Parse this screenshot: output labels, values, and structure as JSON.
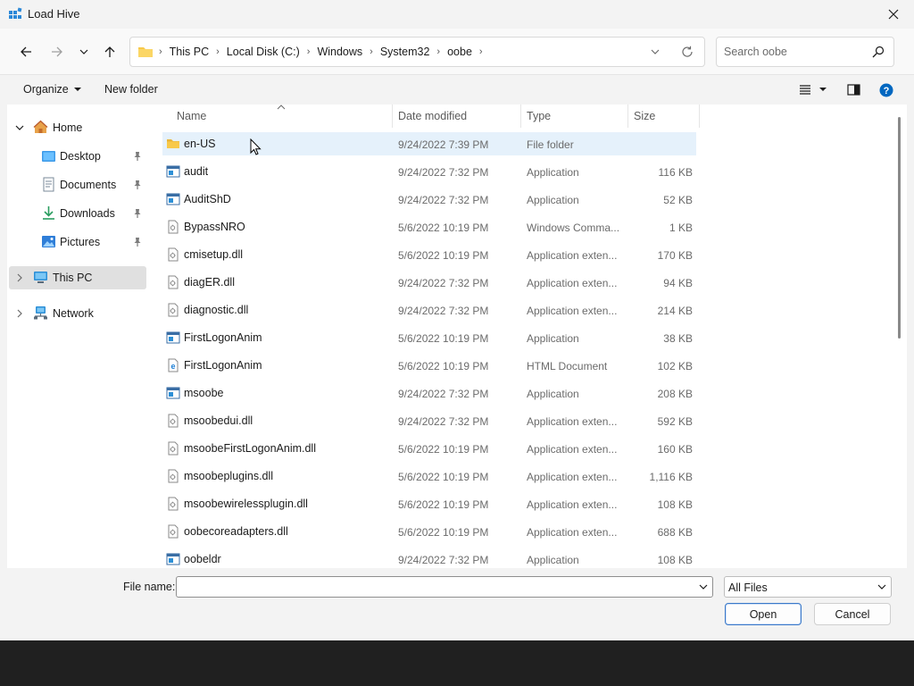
{
  "window": {
    "title": "Load Hive"
  },
  "address": {
    "crumbs": [
      "This PC",
      "Local Disk (C:)",
      "Windows",
      "System32",
      "oobe"
    ]
  },
  "search": {
    "placeholder": "Search oobe"
  },
  "toolbar": {
    "organize_label": "Organize",
    "new_folder_label": "New folder"
  },
  "sidebar": {
    "items": [
      {
        "label": "Home",
        "icon": "home-icon"
      },
      {
        "label": "Desktop",
        "icon": "desktop-icon",
        "pinned": true
      },
      {
        "label": "Documents",
        "icon": "documents-icon",
        "pinned": true
      },
      {
        "label": "Downloads",
        "icon": "downloads-icon",
        "pinned": true
      },
      {
        "label": "Pictures",
        "icon": "pictures-icon",
        "pinned": true
      },
      {
        "label": "This PC",
        "icon": "this-pc-icon",
        "selected": true
      },
      {
        "label": "Network",
        "icon": "network-icon"
      }
    ]
  },
  "columns": {
    "name": "Name",
    "date": "Date modified",
    "type": "Type",
    "size": "Size"
  },
  "files": [
    {
      "name": "en-US",
      "date": "9/24/2022 7:39 PM",
      "type": "File folder",
      "size": "",
      "icon": "folder-icon",
      "selected": true
    },
    {
      "name": "audit",
      "date": "9/24/2022 7:32 PM",
      "type": "Application",
      "size": "116 KB",
      "icon": "application-icon"
    },
    {
      "name": "AuditShD",
      "date": "9/24/2022 7:32 PM",
      "type": "Application",
      "size": "52 KB",
      "icon": "application-icon"
    },
    {
      "name": "BypassNRO",
      "date": "5/6/2022 10:19 PM",
      "type": "Windows Comma...",
      "size": "1 KB",
      "icon": "script-icon"
    },
    {
      "name": "cmisetup.dll",
      "date": "5/6/2022 10:19 PM",
      "type": "Application exten...",
      "size": "170 KB",
      "icon": "dll-icon"
    },
    {
      "name": "diagER.dll",
      "date": "9/24/2022 7:32 PM",
      "type": "Application exten...",
      "size": "94 KB",
      "icon": "dll-icon"
    },
    {
      "name": "diagnostic.dll",
      "date": "9/24/2022 7:32 PM",
      "type": "Application exten...",
      "size": "214 KB",
      "icon": "dll-icon"
    },
    {
      "name": "FirstLogonAnim",
      "date": "5/6/2022 10:19 PM",
      "type": "Application",
      "size": "38 KB",
      "icon": "application-icon"
    },
    {
      "name": "FirstLogonAnim",
      "date": "5/6/2022 10:19 PM",
      "type": "HTML Document",
      "size": "102 KB",
      "icon": "html-document-icon"
    },
    {
      "name": "msoobe",
      "date": "9/24/2022 7:32 PM",
      "type": "Application",
      "size": "208 KB",
      "icon": "application-icon"
    },
    {
      "name": "msoobedui.dll",
      "date": "9/24/2022 7:32 PM",
      "type": "Application exten...",
      "size": "592 KB",
      "icon": "dll-icon"
    },
    {
      "name": "msoobeFirstLogonAnim.dll",
      "date": "5/6/2022 10:19 PM",
      "type": "Application exten...",
      "size": "160 KB",
      "icon": "dll-icon"
    },
    {
      "name": "msoobeplugins.dll",
      "date": "5/6/2022 10:19 PM",
      "type": "Application exten...",
      "size": "1,116 KB",
      "icon": "dll-icon"
    },
    {
      "name": "msoobewirelessplugin.dll",
      "date": "5/6/2022 10:19 PM",
      "type": "Application exten...",
      "size": "108 KB",
      "icon": "dll-icon"
    },
    {
      "name": "oobecoreadapters.dll",
      "date": "5/6/2022 10:19 PM",
      "type": "Application exten...",
      "size": "688 KB",
      "icon": "dll-icon"
    },
    {
      "name": "oobeldr",
      "date": "9/24/2022 7:32 PM",
      "type": "Application",
      "size": "108 KB",
      "icon": "application-icon"
    }
  ],
  "bottom": {
    "file_name_label": "File name:",
    "file_name_value": "",
    "filter_value": "All Files",
    "open_label": "Open",
    "cancel_label": "Cancel"
  },
  "colors": {
    "accent": "#0067c0",
    "selection": "#e5f1fb",
    "folder": "#f8c94a"
  }
}
